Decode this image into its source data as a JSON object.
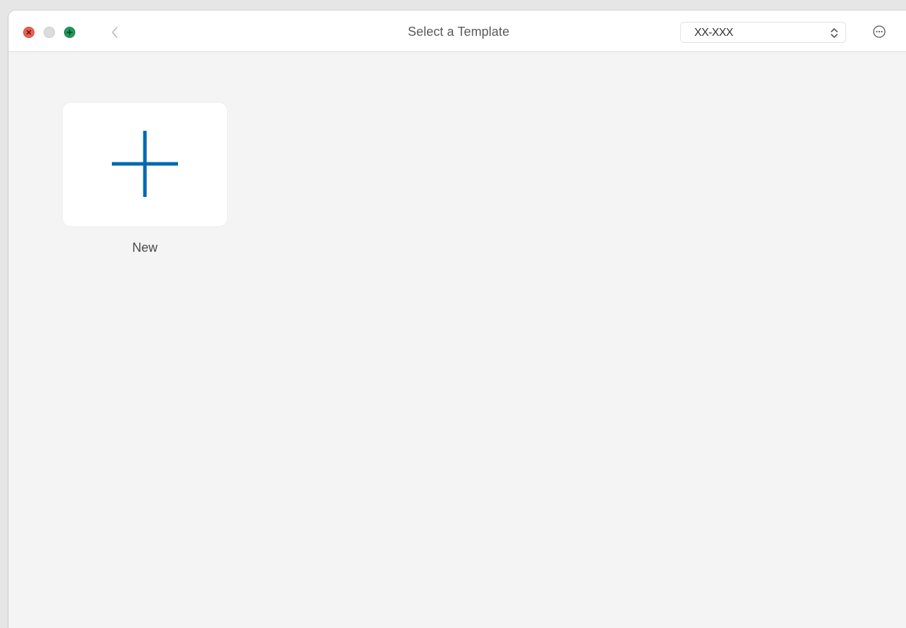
{
  "window": {
    "title": "Select a Template"
  },
  "toolbar": {
    "back_icon": "chevron-left-icon",
    "more_icon": "ellipsis-circle-icon",
    "model_select": {
      "value": "XX-XXX",
      "icon": "chevron-up-down-icon"
    }
  },
  "templates": [
    {
      "label": "New",
      "icon": "plus-icon",
      "icon_color": "#0068b1"
    }
  ],
  "colors": {
    "close": "#ec5f51",
    "minimize": "#dcdcdc",
    "zoom": "#1f9a5b",
    "accent": "#0068b1"
  }
}
